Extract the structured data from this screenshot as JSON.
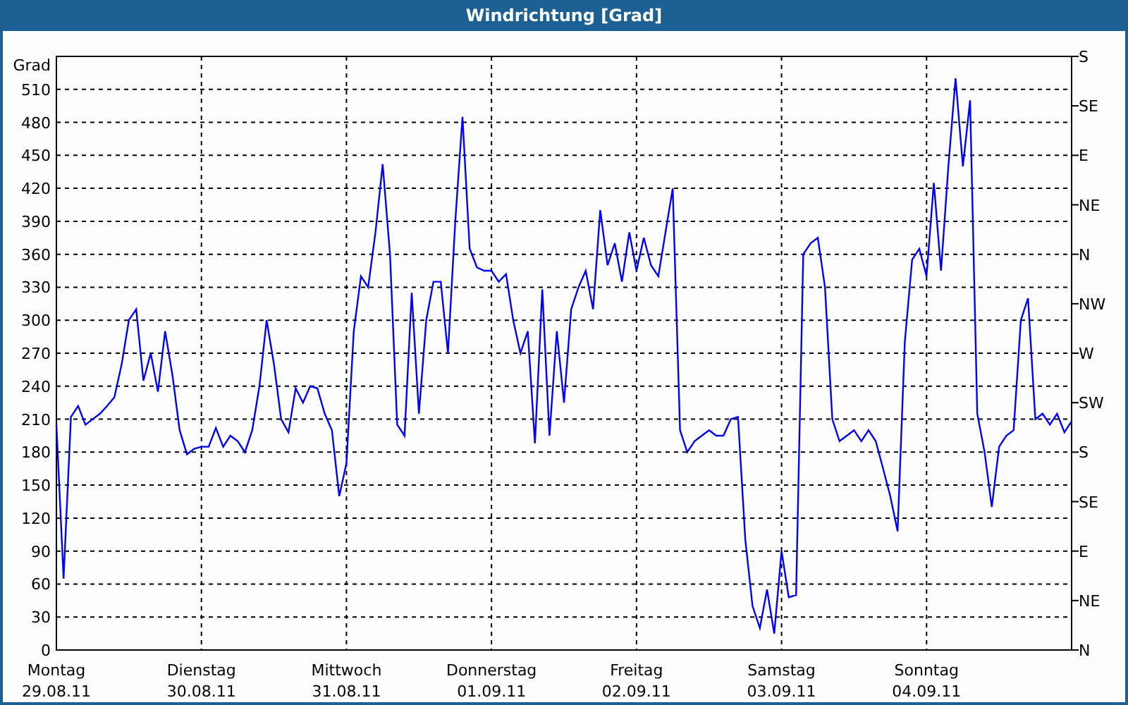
{
  "window": {
    "title": "Windrichtung [Grad]"
  },
  "chart": {
    "right_axis_labels": [
      "S",
      "SE",
      "E",
      "NE",
      "N",
      "NW",
      "W",
      "SW",
      "S",
      "SE",
      "E",
      "NE",
      "N"
    ],
    "chart_data": {
      "type": "line",
      "grid": true,
      "ylabel": "Grad",
      "ylim": [
        0,
        540
      ],
      "yticks": [
        0,
        30,
        60,
        90,
        120,
        150,
        180,
        210,
        240,
        270,
        300,
        330,
        360,
        390,
        420,
        450,
        480,
        510
      ],
      "categories": [
        "Montag\n29.08.11",
        null,
        null,
        null,
        null,
        null,
        null,
        null,
        null,
        null,
        null,
        null,
        null,
        null,
        null,
        null,
        null,
        null,
        null,
        null,
        "Dienstag\n30.08.11",
        null,
        null,
        null,
        null,
        null,
        null,
        null,
        null,
        null,
        null,
        null,
        null,
        null,
        null,
        null,
        null,
        null,
        null,
        null,
        "Mittwoch\n31.08.11",
        null,
        null,
        null,
        null,
        null,
        null,
        null,
        null,
        null,
        null,
        null,
        null,
        null,
        null,
        null,
        null,
        null,
        null,
        null,
        "Donnerstag\n01.09.11",
        null,
        null,
        null,
        null,
        null,
        null,
        null,
        null,
        null,
        null,
        null,
        null,
        null,
        null,
        null,
        null,
        null,
        null,
        null,
        "Freitag\n02.09.11",
        null,
        null,
        null,
        null,
        null,
        null,
        null,
        null,
        null,
        null,
        null,
        null,
        null,
        null,
        null,
        null,
        null,
        null,
        null,
        "Samstag\n03.09.11",
        null,
        null,
        null,
        null,
        null,
        null,
        null,
        null,
        null,
        null,
        null,
        null,
        null,
        null,
        null,
        null,
        null,
        null,
        null,
        "Sonntag\n04.09.11",
        null,
        null,
        null,
        null,
        null,
        null,
        null,
        null,
        null,
        null,
        null,
        null,
        null,
        null,
        null,
        null,
        null,
        null,
        null,
        null
      ],
      "series": [
        {
          "color": "#0000ff",
          "values": [
            205,
            65,
            212,
            222,
            205,
            210,
            215,
            222,
            230,
            260,
            300,
            310,
            245,
            270,
            235,
            290,
            250,
            200,
            178,
            183,
            185,
            185,
            202,
            185,
            195,
            190,
            180,
            200,
            240,
            300,
            260,
            210,
            198,
            238,
            225,
            240,
            238,
            215,
            200,
            140,
            170,
            290,
            340,
            330,
            380,
            442,
            360,
            205,
            195,
            325,
            215,
            300,
            335,
            335,
            270,
            390,
            485,
            365,
            348,
            345,
            345,
            335,
            342,
            300,
            270,
            290,
            188,
            328,
            195,
            290,
            225,
            310,
            330,
            345,
            310,
            400,
            350,
            370,
            335,
            380,
            345,
            375,
            350,
            340,
            380,
            420,
            200,
            180,
            190,
            195,
            200,
            195,
            195,
            210,
            212,
            100,
            40,
            20,
            55,
            15,
            90,
            48,
            50,
            360,
            370,
            375,
            330,
            210,
            190,
            195,
            200,
            190,
            200,
            190,
            165,
            140,
            108,
            280,
            355,
            365,
            340,
            425,
            345,
            440,
            520,
            440,
            500,
            215,
            180,
            130,
            185,
            195,
            200,
            300,
            320,
            210,
            215,
            205,
            215,
            198,
            208
          ]
        }
      ]
    }
  }
}
